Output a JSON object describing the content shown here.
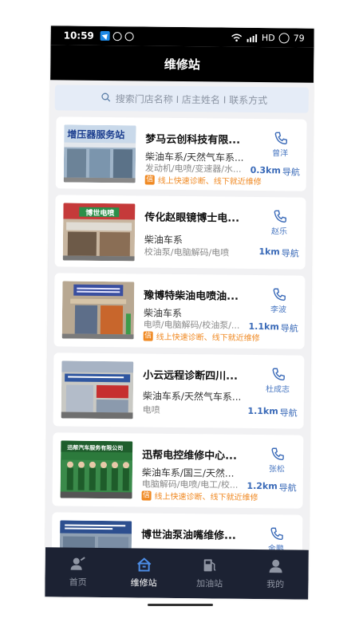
{
  "status_bar": {
    "time": "10:59",
    "network": "HD",
    "battery": "79"
  },
  "header": {
    "title": "维修站"
  },
  "search": {
    "placeholder": "搜索门店名称 I 店主姓名 I 联系方式"
  },
  "stations": [
    {
      "name": "梦马云创科技有限...",
      "category": "柴油车系/天然气车系...",
      "services": "发动机/电喷/变速器/水...",
      "contact": "曾洋",
      "distance": "0.3km",
      "nav_label": "导航",
      "tag_icon": "信",
      "tag": "线上快速诊断、线下就近维修",
      "sign_text": "增压器服务站"
    },
    {
      "name": "传化赵眼镜博士电...",
      "category": "柴油车系",
      "services": "校油泵/电脑解码/电喷",
      "contact": "赵乐",
      "distance": "1km",
      "nav_label": "导航",
      "tag_icon": "",
      "tag": "",
      "sign_text": "博世电喷"
    },
    {
      "name": "豫博特柴油电喷油...",
      "category": "柴油车系",
      "services": "电喷/电脑解码/校油泵/...",
      "contact": "李波",
      "distance": "1.1km",
      "nav_label": "导航",
      "tag_icon": "信",
      "tag": "线上快速诊断、线下就近维修",
      "sign_text": ""
    },
    {
      "name": "小云远程诊断四川...",
      "category": "柴油车系/天然气车系...",
      "services": "电喷",
      "contact": "杜成志",
      "distance": "1.1km",
      "nav_label": "导航",
      "tag_icon": "",
      "tag": "",
      "sign_text": ""
    },
    {
      "name": "迅帮电控维修中心...",
      "category": "柴油车系/国三/天然...",
      "services": "电脑解码/电喷/电工/校...",
      "contact": "张松",
      "distance": "1.2km",
      "nav_label": "导航",
      "tag_icon": "信",
      "tag": "线上快速诊断、线下就近维修",
      "sign_text": "迅帮汽车服务有限公司"
    },
    {
      "name": "博世油泵油嘴维修...",
      "category": "",
      "services": "",
      "contact": "金鹏",
      "distance": "",
      "nav_label": "",
      "tag_icon": "",
      "tag": "",
      "sign_text": ""
    }
  ],
  "tabs": [
    {
      "label": "首页",
      "icon": "home-mechanic-icon",
      "active": false
    },
    {
      "label": "维修站",
      "icon": "repair-station-icon",
      "active": true
    },
    {
      "label": "加油站",
      "icon": "fuel-pump-icon",
      "active": false
    },
    {
      "label": "我的",
      "icon": "profile-icon",
      "active": false
    }
  ],
  "colors": {
    "accent": "#3a6ab8",
    "tag": "#f08a24",
    "tabbar": "#1c2233"
  }
}
